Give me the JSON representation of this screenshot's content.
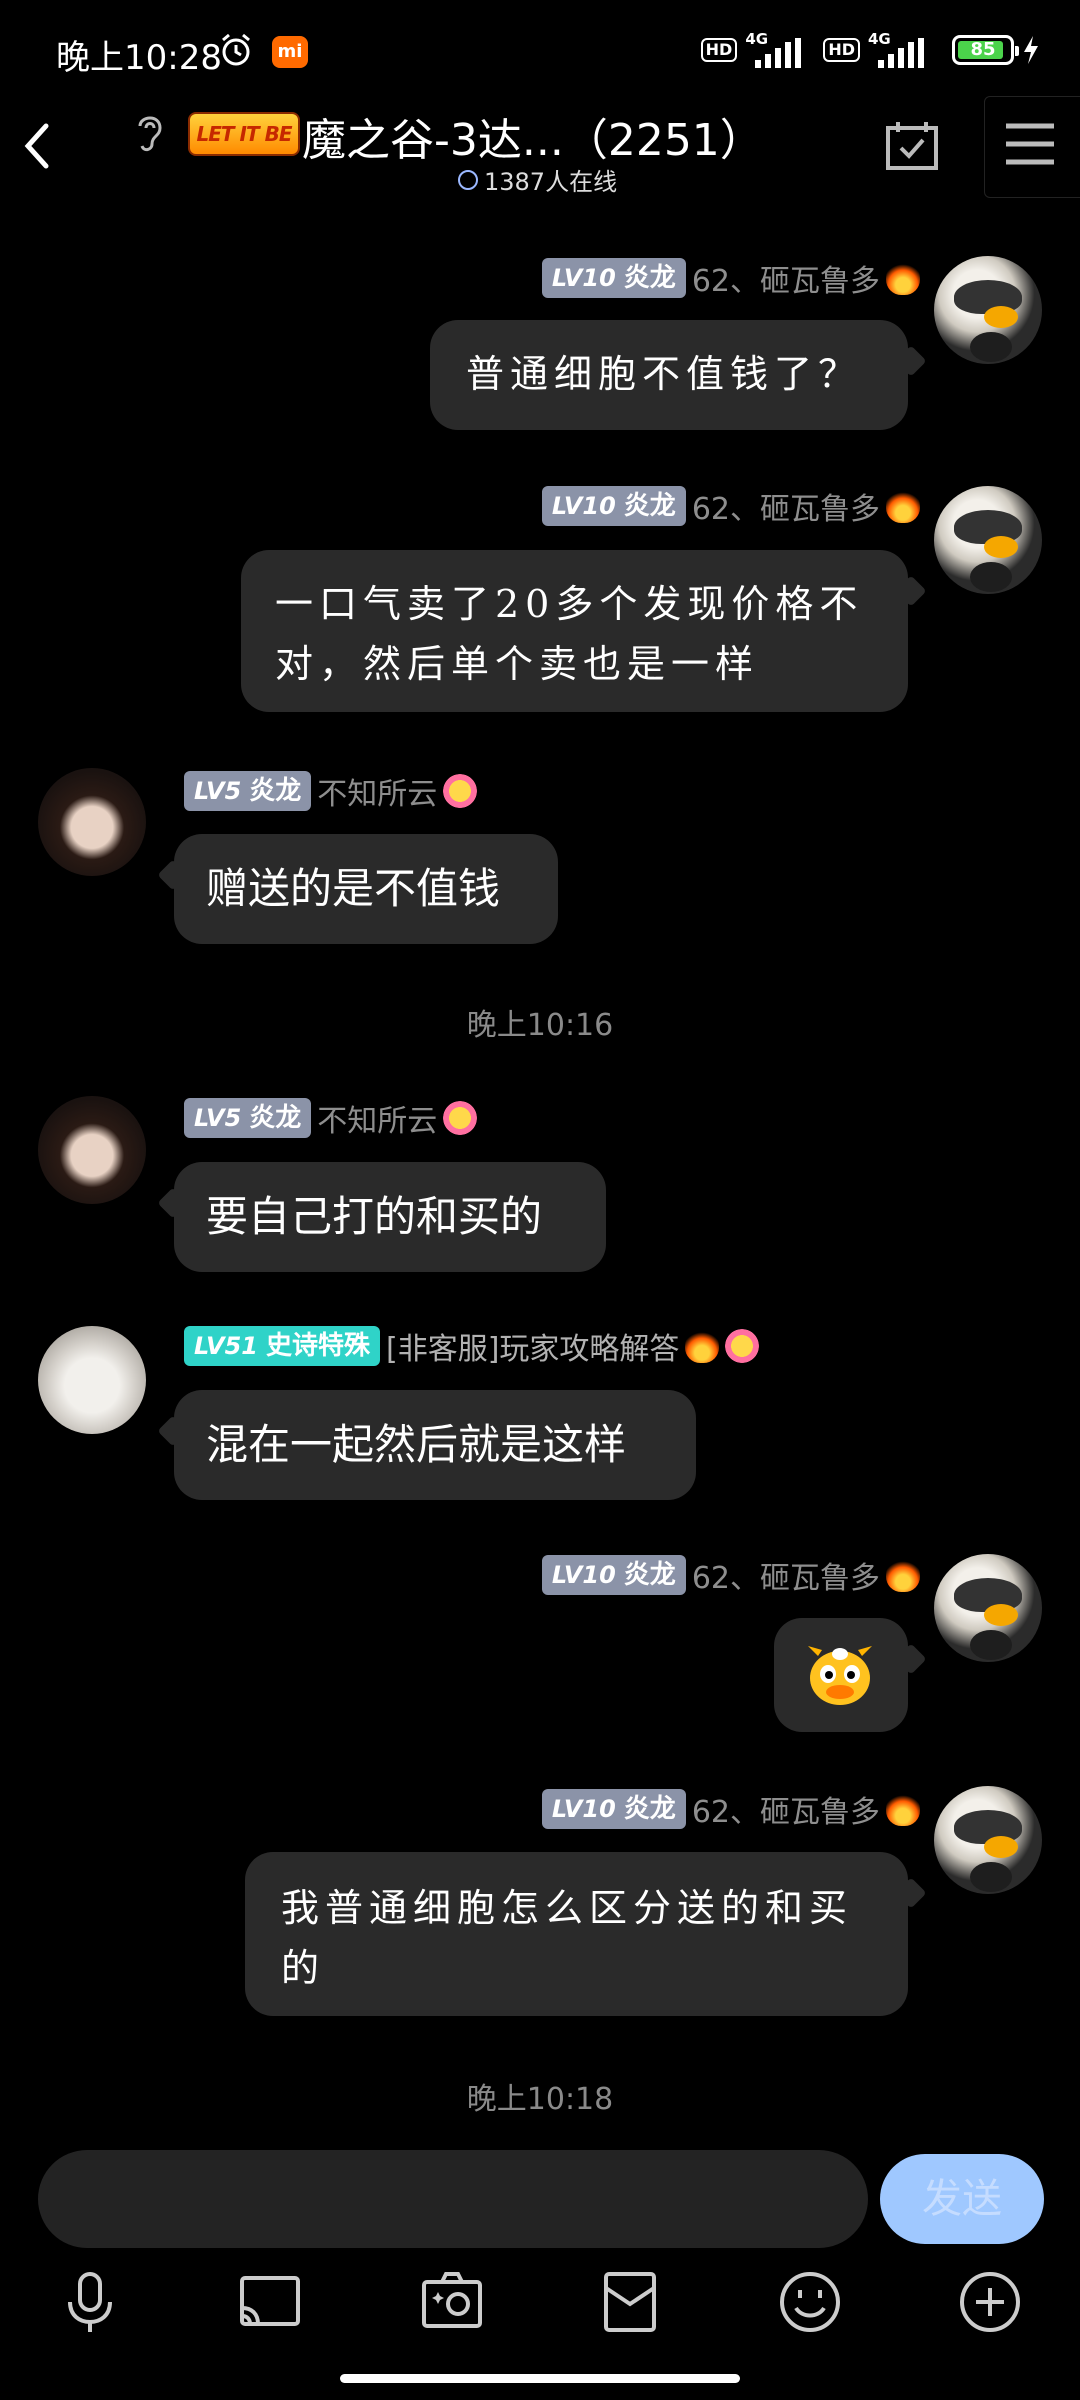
{
  "status_bar": {
    "time": "晚上10:28",
    "mi_label": "mi",
    "hd1": "HD",
    "net1": "4G",
    "hd2": "HD",
    "net2": "4G",
    "battery": "85"
  },
  "header": {
    "logo_text": "LET IT BE",
    "title": "魔之谷-3达...（2251）",
    "online": "1387人在线"
  },
  "messages": [
    {
      "side": "right",
      "level": "LV10",
      "rank": "炎龙",
      "name": "62、砸瓦鲁多",
      "text": "普通细胞不值钱了？"
    },
    {
      "side": "right",
      "level": "LV10",
      "rank": "炎龙",
      "name": "62、砸瓦鲁多",
      "text_lines": [
        "一口气卖了20多个发现价格不",
        "对，然后单个卖也是一样"
      ]
    },
    {
      "side": "left",
      "level": "LV5",
      "rank": "炎龙",
      "name": "不知所云",
      "text": "赠送的是不值钱"
    },
    {
      "side": "left",
      "level": "LV5",
      "rank": "炎龙",
      "name": "不知所云",
      "text": "要自己打的和买的"
    },
    {
      "side": "left",
      "level": "LV51",
      "rank": "史诗特殊",
      "name": "[非客服]玩家攻略解答",
      "text": "混在一起然后就是这样"
    },
    {
      "side": "right",
      "level": "LV10",
      "rank": "炎龙",
      "name": "62、砸瓦鲁多",
      "sticker": "cow-sticker"
    },
    {
      "side": "right",
      "level": "LV10",
      "rank": "炎龙",
      "name": "62、砸瓦鲁多",
      "text_lines": [
        "我普通细胞怎么区分送的和买",
        "的"
      ]
    }
  ],
  "timestamps": [
    "晚上10:16",
    "晚上10:18"
  ],
  "input_bar": {
    "placeholder": "",
    "send_label": "发送",
    "tools": [
      "microphone-icon",
      "cast-icon",
      "photo-icon",
      "red-packet-icon",
      "emoji-icon",
      "plus-icon"
    ]
  },
  "colors": {
    "background": "#000000",
    "bubble": "#2a2a2a",
    "badge_gray": "#8b93a8",
    "badge_teal": "#2fd3c8",
    "send_button": "#9fc8ff"
  }
}
